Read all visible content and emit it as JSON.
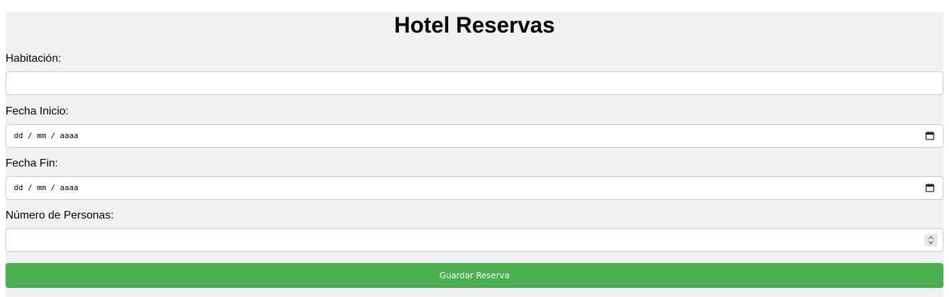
{
  "page": {
    "title": "Hotel Reservas"
  },
  "form": {
    "room_label": "Habitación:",
    "room_value": "",
    "start_label": "Fecha Inicio:",
    "start_value": "dd / mm / aaaa",
    "end_label": "Fecha Fin:",
    "end_value": "dd / mm / aaaa",
    "people_label": "Número de Personas:",
    "people_value": "",
    "submit_label": "Guardar Reserva"
  },
  "colors": {
    "background": "#f1f1f1",
    "button": "#4caf50",
    "button_text": "#ffffff"
  },
  "icons": {
    "date": "calendar-icon",
    "number": "spinner-icon"
  }
}
